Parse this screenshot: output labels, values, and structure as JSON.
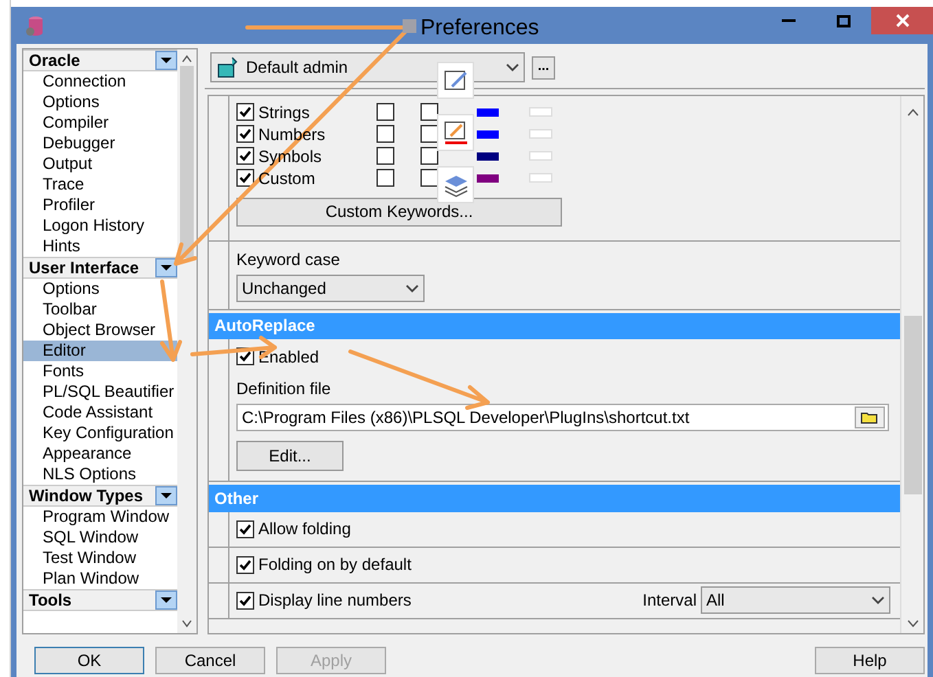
{
  "window": {
    "title": "Preferences"
  },
  "tree": [
    {
      "label": "Oracle",
      "items": [
        {
          "label": "Connection",
          "selected": false
        },
        {
          "label": "Options",
          "selected": false
        },
        {
          "label": "Compiler",
          "selected": false
        },
        {
          "label": "Debugger",
          "selected": false
        },
        {
          "label": "Output",
          "selected": false
        },
        {
          "label": "Trace",
          "selected": false
        },
        {
          "label": "Profiler",
          "selected": false
        },
        {
          "label": "Logon History",
          "selected": false
        },
        {
          "label": "Hints",
          "selected": false
        }
      ]
    },
    {
      "label": "User Interface",
      "items": [
        {
          "label": "Options",
          "selected": false
        },
        {
          "label": "Toolbar",
          "selected": false
        },
        {
          "label": "Object Browser",
          "selected": false
        },
        {
          "label": "Editor",
          "selected": true
        },
        {
          "label": "Fonts",
          "selected": false
        },
        {
          "label": "PL/SQL Beautifier",
          "selected": false
        },
        {
          "label": "Code Assistant",
          "selected": false
        },
        {
          "label": "Key Configuration",
          "selected": false
        },
        {
          "label": "Appearance",
          "selected": false
        },
        {
          "label": "NLS Options",
          "selected": false
        }
      ]
    },
    {
      "label": "Window Types",
      "items": [
        {
          "label": "Program Window",
          "selected": false
        },
        {
          "label": "SQL Window",
          "selected": false
        },
        {
          "label": "Test Window",
          "selected": false
        },
        {
          "label": "Plan Window",
          "selected": false
        }
      ]
    },
    {
      "label": "Tools"
    }
  ],
  "profile": {
    "value": "Default admin",
    "more_button": "..."
  },
  "syntax_rows": [
    {
      "label": "Strings",
      "checked": true,
      "bold": false,
      "italic": false,
      "color": "#0000ff"
    },
    {
      "label": "Numbers",
      "checked": true,
      "bold": false,
      "italic": false,
      "color": "#0000ff"
    },
    {
      "label": "Symbols",
      "checked": true,
      "bold": false,
      "italic": false,
      "color": "#000080"
    },
    {
      "label": "Custom",
      "checked": true,
      "bold": false,
      "italic": false,
      "color": "#800080"
    }
  ],
  "custom_keywords_button": "Custom Keywords...",
  "keyword_case": {
    "label": "Keyword case",
    "value": "Unchanged"
  },
  "autoreplace": {
    "title": "AutoReplace",
    "enabled": {
      "label": "Enabled",
      "checked": true
    },
    "definition_label": "Definition file",
    "definition_value": "C:\\Program Files (x86)\\PLSQL Developer\\PlugIns\\shortcut.txt",
    "edit_button": "Edit..."
  },
  "other": {
    "title": "Other",
    "options": [
      {
        "label": "Allow folding",
        "checked": true
      },
      {
        "label": "Folding on by default",
        "checked": true
      },
      {
        "label": "Display line numbers",
        "checked": true,
        "interval_label": "Interval",
        "interval_value": "All"
      }
    ]
  },
  "buttons": [
    {
      "label": "OK",
      "disabled": false,
      "default": true
    },
    {
      "label": "Cancel",
      "disabled": false,
      "default": false
    },
    {
      "label": "Apply",
      "disabled": true,
      "default": false
    },
    {
      "label": "Help",
      "disabled": false,
      "default": false
    }
  ]
}
